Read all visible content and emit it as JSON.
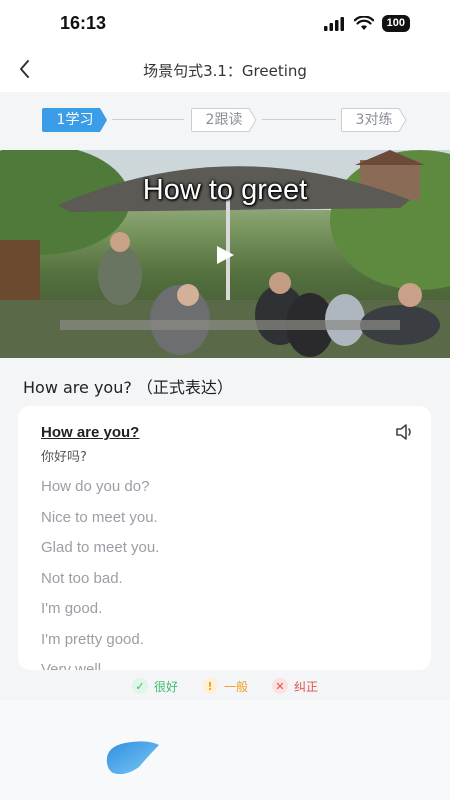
{
  "status_bar": {
    "time": "16:13",
    "battery": "100"
  },
  "nav": {
    "title": "场景句式3.1：Greeting"
  },
  "stepper": {
    "steps": [
      {
        "label": "1学习",
        "active": true
      },
      {
        "label": "2跟读",
        "active": false
      },
      {
        "label": "3对练",
        "active": false
      }
    ]
  },
  "video": {
    "caption": "How to greet"
  },
  "heading": {
    "text": "How are you? （正式表达）"
  },
  "card": {
    "main_phrase": "How are you?",
    "main_translation": "你好吗?",
    "alternatives": [
      "How do you do?",
      "Nice to meet you.",
      "Glad to meet you.",
      "Not too bad.",
      "I'm good.",
      "I'm pretty good.",
      "Very well."
    ]
  },
  "legend": {
    "good": {
      "label": "很好",
      "color": "#3dbb6f",
      "bg": "#dff5e7"
    },
    "ok": {
      "label": "一般",
      "color": "#f0a020",
      "bg": "#fdf0d6"
    },
    "correct": {
      "label": "纠正",
      "color": "#e0524f",
      "bg": "#fbe1e0"
    }
  },
  "colors": {
    "accent": "#3b9de8"
  }
}
